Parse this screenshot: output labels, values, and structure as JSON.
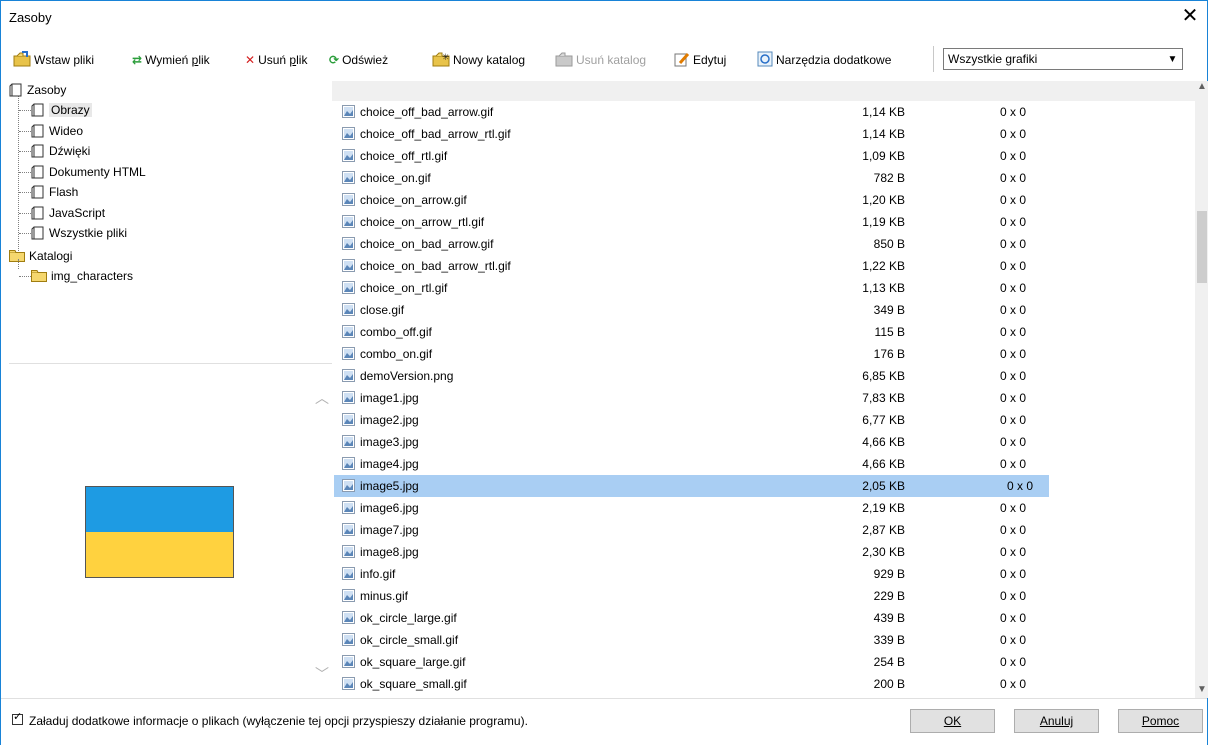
{
  "window": {
    "title": "Zasoby"
  },
  "toolbar": {
    "insert": "Wstaw pliki",
    "replace": "Wymień plik",
    "delete": "Usuń plik",
    "refresh": "Odśwież",
    "new_folder": "Nowy katalog",
    "delete_folder": "Usuń katalog",
    "edit": "Edytuj",
    "tools": "Narzędzia dodatkowe",
    "filter_value": "Wszystkie grafiki"
  },
  "tree": {
    "root": "Zasoby",
    "resources": [
      "Obrazy",
      "Wideo",
      "Dźwięki",
      "Dokumenty HTML",
      "Flash",
      "JavaScript",
      "Wszystkie pliki"
    ],
    "folders_root": "Katalogi",
    "folders": [
      "img_characters"
    ]
  },
  "preview": {
    "flag_top_color": "#1e9be3",
    "flag_bottom_color": "#ffd23f"
  },
  "files": [
    {
      "name": "choice_off_bad_arrow.gif",
      "size": "1,14 KB",
      "dim": "0 x 0"
    },
    {
      "name": "choice_off_bad_arrow_rtl.gif",
      "size": "1,14 KB",
      "dim": "0 x 0"
    },
    {
      "name": "choice_off_rtl.gif",
      "size": "1,09 KB",
      "dim": "0 x 0"
    },
    {
      "name": "choice_on.gif",
      "size": "782 B",
      "dim": "0 x 0"
    },
    {
      "name": "choice_on_arrow.gif",
      "size": "1,20 KB",
      "dim": "0 x 0"
    },
    {
      "name": "choice_on_arrow_rtl.gif",
      "size": "1,19 KB",
      "dim": "0 x 0"
    },
    {
      "name": "choice_on_bad_arrow.gif",
      "size": "850 B",
      "dim": "0 x 0"
    },
    {
      "name": "choice_on_bad_arrow_rtl.gif",
      "size": "1,22 KB",
      "dim": "0 x 0"
    },
    {
      "name": "choice_on_rtl.gif",
      "size": "1,13 KB",
      "dim": "0 x 0"
    },
    {
      "name": "close.gif",
      "size": "349 B",
      "dim": "0 x 0"
    },
    {
      "name": "combo_off.gif",
      "size": "115 B",
      "dim": "0 x 0"
    },
    {
      "name": "combo_on.gif",
      "size": "176 B",
      "dim": "0 x 0"
    },
    {
      "name": "demoVersion.png",
      "size": "6,85 KB",
      "dim": "0 x 0"
    },
    {
      "name": "image1.jpg",
      "size": "7,83 KB",
      "dim": "0 x 0"
    },
    {
      "name": "image2.jpg",
      "size": "6,77 KB",
      "dim": "0 x 0"
    },
    {
      "name": "image3.jpg",
      "size": "4,66 KB",
      "dim": "0 x 0"
    },
    {
      "name": "image4.jpg",
      "size": "4,66 KB",
      "dim": "0 x 0"
    },
    {
      "name": "image5.jpg",
      "size": "2,05 KB",
      "dim": "0 x 0",
      "selected": true
    },
    {
      "name": "image6.jpg",
      "size": "2,19 KB",
      "dim": "0 x 0"
    },
    {
      "name": "image7.jpg",
      "size": "2,87 KB",
      "dim": "0 x 0"
    },
    {
      "name": "image8.jpg",
      "size": "2,30 KB",
      "dim": "0 x 0"
    },
    {
      "name": "info.gif",
      "size": "929 B",
      "dim": "0 x 0"
    },
    {
      "name": "minus.gif",
      "size": "229 B",
      "dim": "0 x 0"
    },
    {
      "name": "ok_circle_large.gif",
      "size": "439 B",
      "dim": "0 x 0"
    },
    {
      "name": "ok_circle_small.gif",
      "size": "339 B",
      "dim": "0 x 0"
    },
    {
      "name": "ok_square_large.gif",
      "size": "254 B",
      "dim": "0 x 0"
    },
    {
      "name": "ok_square_small.gif",
      "size": "200 B",
      "dim": "0 x 0"
    }
  ],
  "bottom": {
    "checkbox_label": "Załaduj dodatkowe informacje o plikach (wyłączenie tej opcji przyspieszy działanie programu).",
    "ok": "OK",
    "cancel": "Anuluj",
    "help": "Pomoc"
  }
}
